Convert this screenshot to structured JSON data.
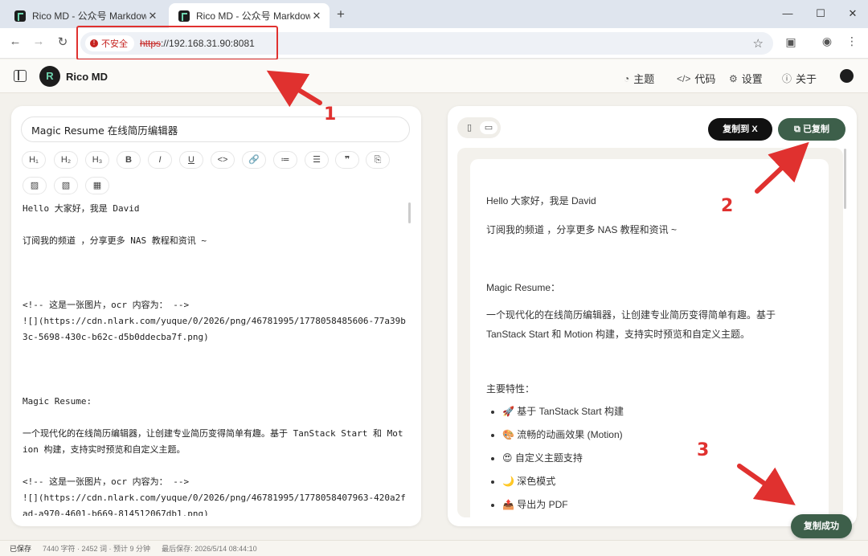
{
  "browser": {
    "tabs": [
      {
        "title": "Rico MD - 公众号 Markdown",
        "close": "✕"
      },
      {
        "title": "Rico MD - 公众号 Markdown",
        "close": "✕"
      }
    ],
    "new_tab": "+",
    "security_label": "不安全",
    "url_protocol": "https",
    "url_rest": "://192.168.31.90:8081"
  },
  "app": {
    "name": "Rico MD",
    "logo_text": "R",
    "nav": [
      {
        "icon": "palette-icon",
        "label": "主题"
      },
      {
        "icon": "code-icon",
        "label": "代码"
      },
      {
        "icon": "settings-icon",
        "label": "设置"
      },
      {
        "icon": "info-icon",
        "label": "关于"
      }
    ]
  },
  "editor": {
    "title_value": "Magic Resume 在线简历编辑器",
    "toolbar": [
      "H1",
      "H2",
      "H3",
      "B",
      "I",
      "U",
      "<>",
      "link",
      "ol",
      "ul",
      "quote",
      "code-block",
      "image",
      "image-edit",
      "table"
    ],
    "lines": [
      "Hello 大家好，我是 David",
      "",
      "订阅我的频道 ，分享更多 NAS 教程和资讯 ~",
      "",
      "",
      "",
      "<!-- 这是一张图片，ocr 内容为： -->",
      "![](https://cdn.nlark.com/yuque/0/2026/png/46781995/1778058485606-77a39b3c-5698-430c-b62c-d5b0ddecba7f.png)",
      "",
      "",
      "",
      "Magic Resume:",
      "",
      "一个现代化的在线简历编辑器，让创建专业简历变得简单有趣。基于 TanStack Start 和 Motion 构建，支持实时预览和自定义主题。",
      "",
      "<!-- 这是一张图片，ocr 内容为： -->",
      "![](https://cdn.nlark.com/yuque/0/2026/png/46781995/1778058407963-420a2fad-a970-4601-b669-814512067db1.png)"
    ]
  },
  "preview": {
    "copy_to_x": "复制到 X",
    "copied": "已复制",
    "paragraphs": [
      "Hello 大家好，我是 David",
      "订阅我的频道 ，分享更多 NAS 教程和资讯 ~",
      "",
      "Magic Resume：",
      "一个现代化的在线简历编辑器，让创建专业简历变得简单有趣。基于 TanStack Start 和 Motion 构建，支持实时预览和自定义主题。",
      "",
      "主要特性："
    ],
    "features": [
      "🚀 基于 TanStack Start 构建",
      "🎨 流畅的动画效果 (Motion)",
      "😍 自定义主题支持",
      "🌙 深色模式",
      "📤 导出为 PDF"
    ]
  },
  "toast": "复制成功",
  "status": {
    "saved": "已保存",
    "counts": "7440 字符 · 2452 词 · 预计 9 分钟",
    "last_saved": "最后保存: 2026/5/14 08:44:10"
  },
  "annotations": [
    "1",
    "2",
    "3"
  ],
  "colors": {
    "accent": "#3d5f4a",
    "annotation": "#e0312f",
    "insecure": "#c5221f"
  }
}
